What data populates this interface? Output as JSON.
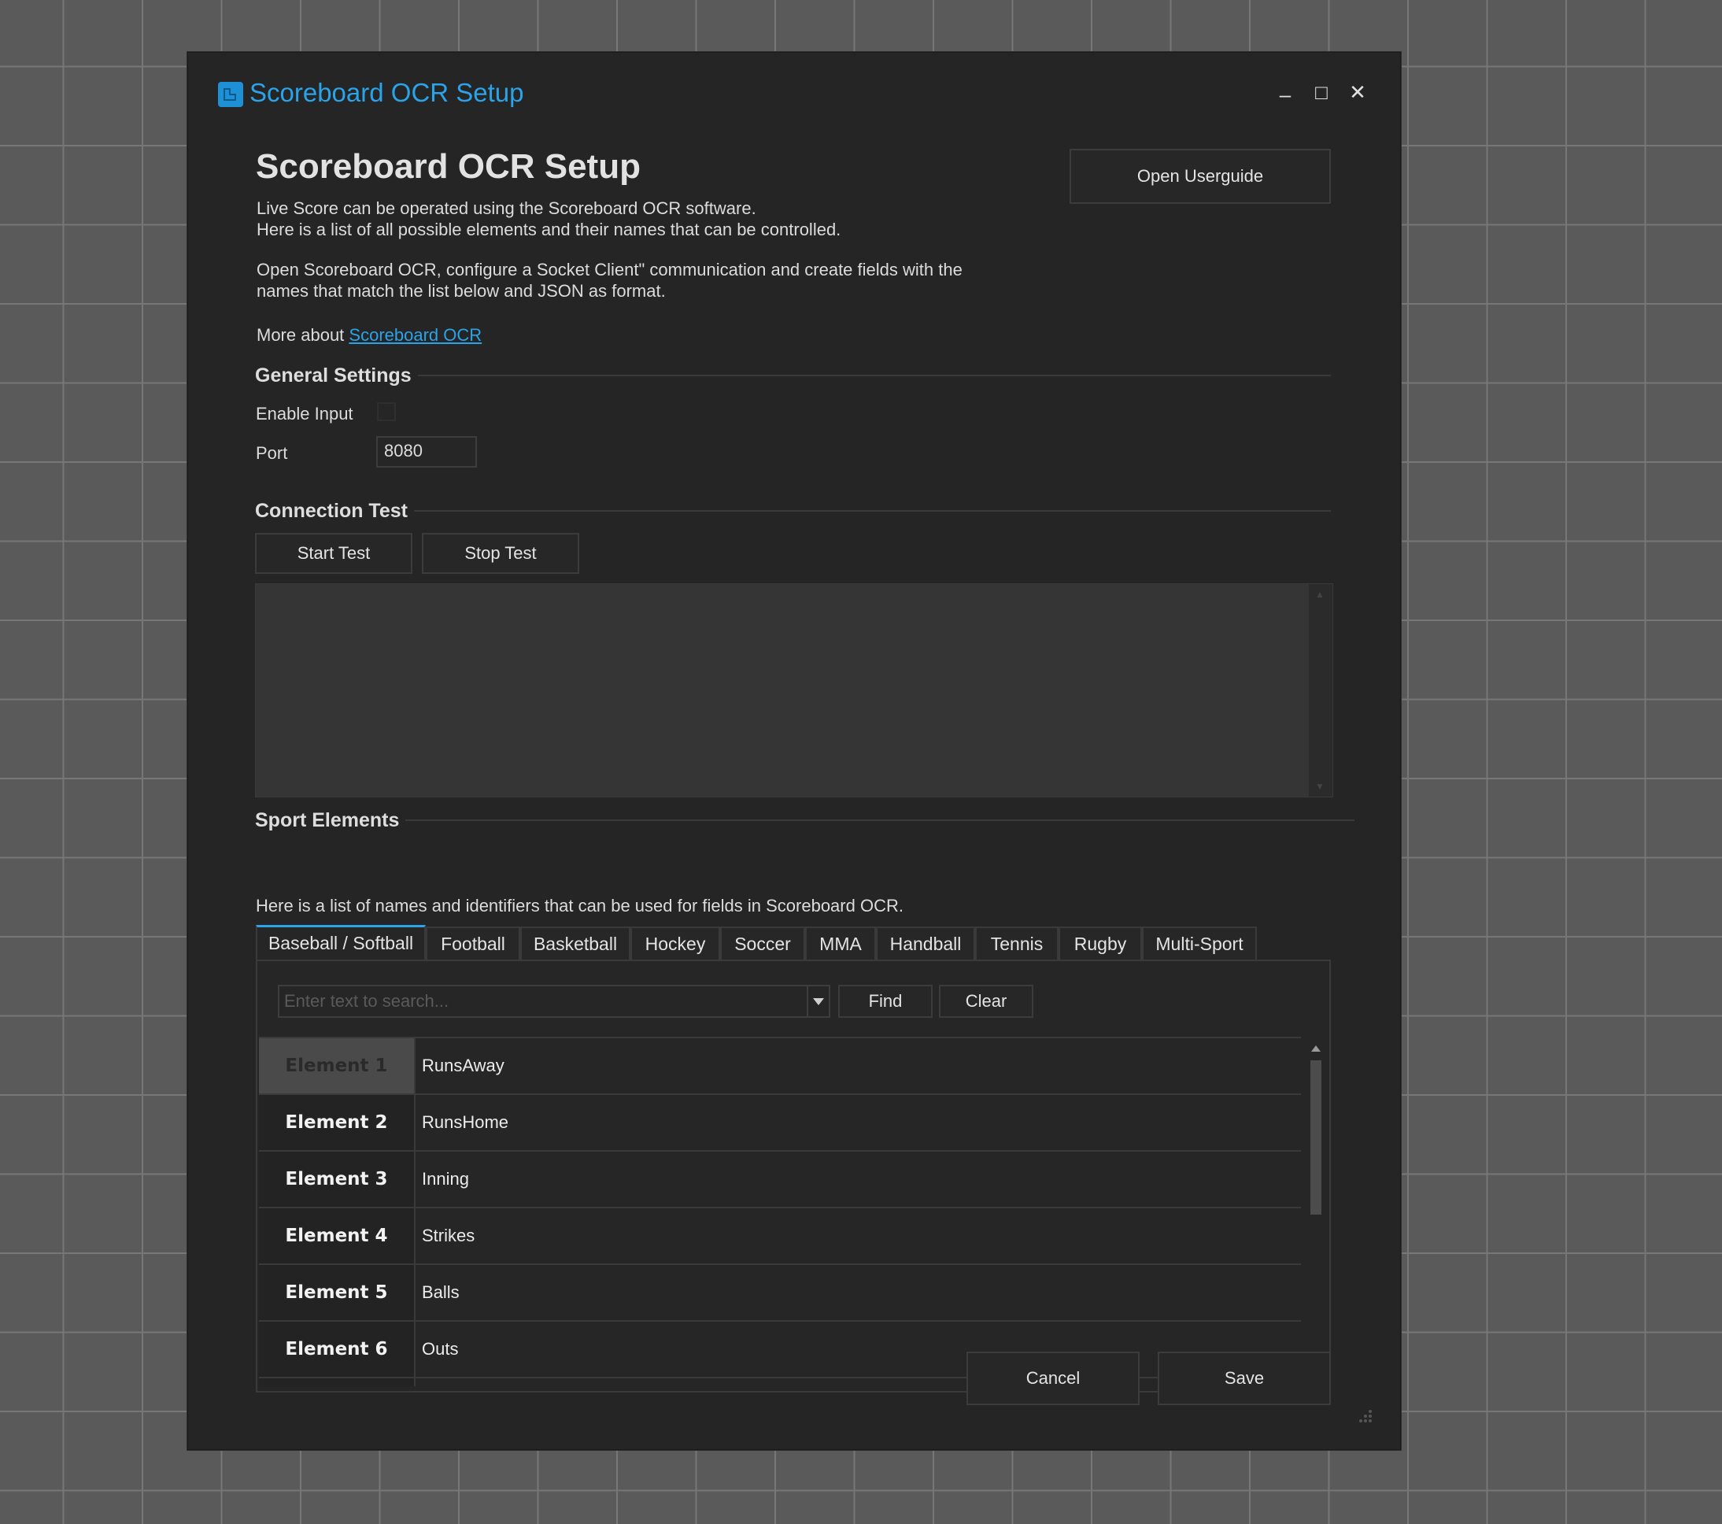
{
  "window": {
    "title": "Scoreboard OCR Setup",
    "controls": {
      "minimize": "–",
      "maximize": "□",
      "close": "✕"
    }
  },
  "header": {
    "heading": "Scoreboard OCR Setup",
    "open_userguide": "Open Userguide",
    "desc_line1": "Live Score can be operated using the Scoreboard OCR software.",
    "desc_line2": "Here is a list of all possible elements and their names that can be controlled.",
    "desc_line3": "Open Scoreboard OCR, configure a Socket Client\" communication and create fields with the",
    "desc_line4": "names that match the list below and JSON as format.",
    "more_about": "More about ",
    "more_about_link": "Scoreboard OCR"
  },
  "general_settings": {
    "title": "General Settings",
    "enable_input_label": "Enable Input",
    "enable_input_checked": false,
    "port_label": "Port",
    "port_value": "8080"
  },
  "connection_test": {
    "title": "Connection Test",
    "start_label": "Start Test",
    "stop_label": "Stop Test"
  },
  "sport_elements": {
    "title": "Sport Elements",
    "description": "Here is a list of names and identifiers that can be used for fields in Scoreboard OCR.",
    "tabs": [
      "Baseball / Softball",
      "Football",
      "Basketball",
      "Hockey",
      "Soccer",
      "MMA",
      "Handball",
      "Tennis",
      "Rugby",
      "Multi-Sport"
    ],
    "active_tab": "Baseball / Softball",
    "search_placeholder": "Enter text to search...",
    "find_label": "Find",
    "clear_label": "Clear",
    "rows": [
      {
        "element": "Element 1",
        "name": "RunsAway"
      },
      {
        "element": "Element 2",
        "name": "RunsHome"
      },
      {
        "element": "Element 3",
        "name": "Inning"
      },
      {
        "element": "Element 4",
        "name": "Strikes"
      },
      {
        "element": "Element 5",
        "name": "Balls"
      },
      {
        "element": "Element 6",
        "name": "Outs"
      }
    ]
  },
  "footer": {
    "cancel_label": "Cancel",
    "save_label": "Save"
  },
  "colors": {
    "accent": "#2aa3e8",
    "background": "#252525",
    "desktop": "#5a5a5a"
  }
}
